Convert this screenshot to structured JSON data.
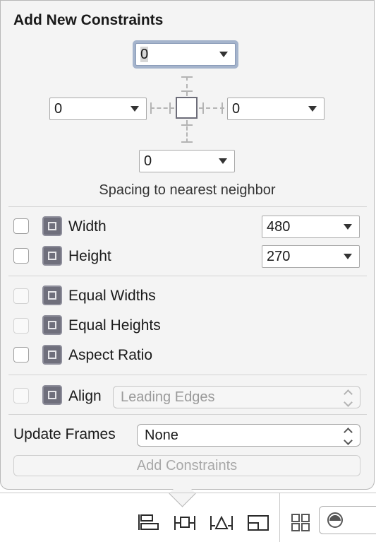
{
  "panel": {
    "title": "Add New Constraints",
    "spacing": {
      "top": "0",
      "left": "0",
      "right": "0",
      "bottom": "0",
      "caption": "Spacing to nearest neighbor"
    },
    "width": {
      "label": "Width",
      "value": "480"
    },
    "height": {
      "label": "Height",
      "value": "270"
    },
    "equal_widths": {
      "label": "Equal Widths"
    },
    "equal_heights": {
      "label": "Equal Heights"
    },
    "aspect_ratio": {
      "label": "Aspect Ratio"
    },
    "align": {
      "label": "Align",
      "value": "Leading Edges"
    },
    "update_frames": {
      "label": "Update Frames",
      "value": "None"
    },
    "add_button": "Add Constraints"
  },
  "toolbar": {
    "icons": [
      "align-icon",
      "pin-icon",
      "resolve-issues-icon",
      "resizing-behavior-icon",
      "size-class-icon",
      "appearance-icon"
    ]
  },
  "colors": {
    "panel_bg": "#f4f4f4",
    "focus_ring": "#a5b4cc",
    "icon_fill": "#6f6f7c"
  }
}
